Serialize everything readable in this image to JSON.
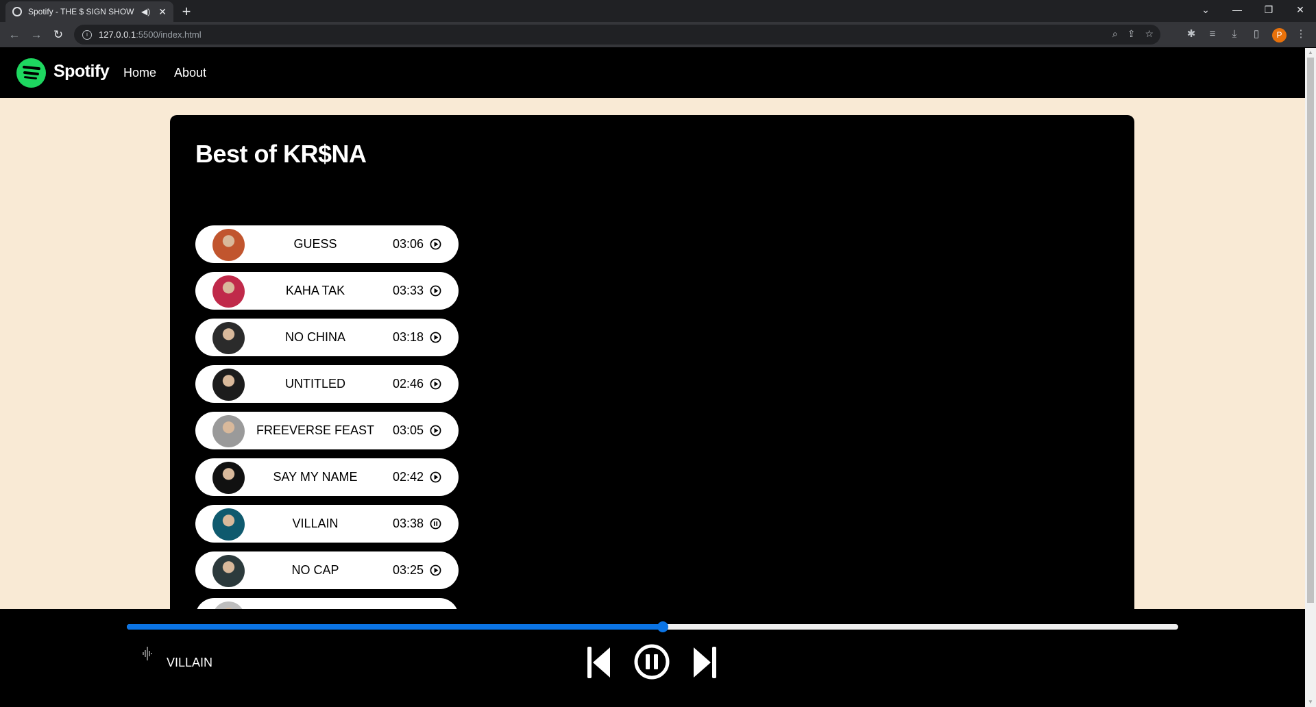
{
  "browser": {
    "tab_title": "Spotify - THE $ SIGN SHOW",
    "url_host": "127.0.0.1",
    "url_path": ":5500/index.html",
    "profile_initial": "P"
  },
  "nav": {
    "brand": "Spotify",
    "links": [
      "Home",
      "About"
    ]
  },
  "playlist": {
    "title": "Best of KR$NA",
    "songs": [
      {
        "name": "GUESS",
        "duration": "03:06",
        "state": "play",
        "thumb": "#c1552e"
      },
      {
        "name": "KAHA TAK",
        "duration": "03:33",
        "state": "play",
        "thumb": "#c02a4a"
      },
      {
        "name": "NO CHINA",
        "duration": "03:18",
        "state": "play",
        "thumb": "#2b2b2b"
      },
      {
        "name": "UNTITLED",
        "duration": "02:46",
        "state": "play",
        "thumb": "#1c1c1c"
      },
      {
        "name": "FREEVERSE FEAST",
        "duration": "03:05",
        "state": "play",
        "thumb": "#9a9a9a"
      },
      {
        "name": "SAY MY NAME",
        "duration": "02:42",
        "state": "play",
        "thumb": "#111111"
      },
      {
        "name": "VILLAIN",
        "duration": "03:38",
        "state": "pause",
        "thumb": "#0f5a6e"
      },
      {
        "name": "NO CAP",
        "duration": "03:25",
        "state": "play",
        "thumb": "#2c3a3c"
      },
      {
        "name": "",
        "duration": "",
        "state": "play",
        "thumb": "#bdbdbd"
      }
    ]
  },
  "player": {
    "now_playing": "VILLAIN",
    "progress_fraction": 0.51,
    "accent": "#0b74e5"
  }
}
